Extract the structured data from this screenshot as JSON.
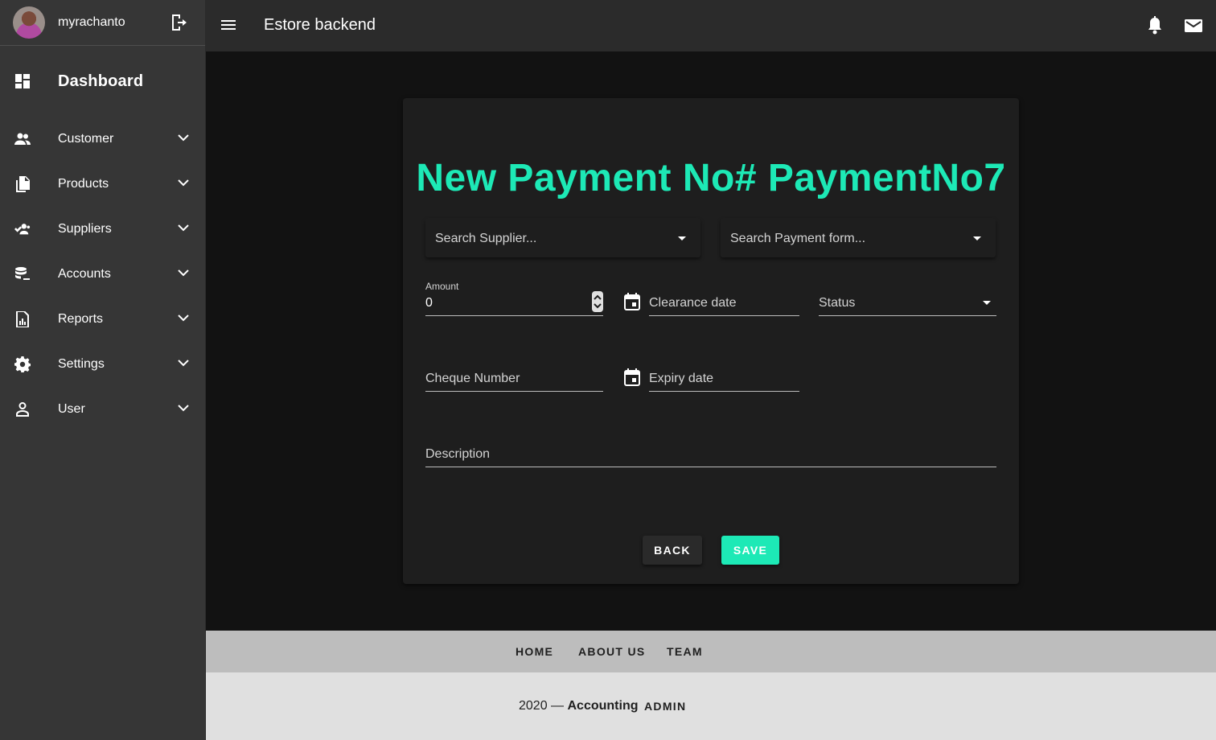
{
  "sidebar": {
    "username": "myrachanto",
    "dashboard_label": "Dashboard",
    "items": [
      {
        "label": "Customer"
      },
      {
        "label": "Products"
      },
      {
        "label": "Suppliers"
      },
      {
        "label": "Accounts"
      },
      {
        "label": "Reports"
      },
      {
        "label": "Settings"
      },
      {
        "label": "User"
      }
    ]
  },
  "topbar": {
    "title": "Estore backend"
  },
  "form": {
    "title": "New Payment No# PaymentNo7",
    "supplier_placeholder": "Search Supplier...",
    "payment_form_placeholder": "Search Payment form...",
    "amount_label": "Amount",
    "amount_value": "0",
    "clearance_date_placeholder": "Clearance date",
    "status_placeholder": "Status",
    "cheque_number_placeholder": "Cheque Number",
    "expiry_date_placeholder": "Expiry date",
    "description_placeholder": "Description",
    "back_label": "BACK",
    "save_label": "SAVE"
  },
  "footer": {
    "links": [
      "HOME",
      "ABOUT US",
      "TEAM"
    ],
    "year": "2020 —",
    "brand": "Accounting",
    "admin": "ADMIN"
  },
  "colors": {
    "accent": "#1de9b6",
    "sidebar_bg": "#363636",
    "topbar_bg": "#2b2b2b",
    "content_bg": "#121212",
    "card_bg": "#1e1e1e"
  }
}
